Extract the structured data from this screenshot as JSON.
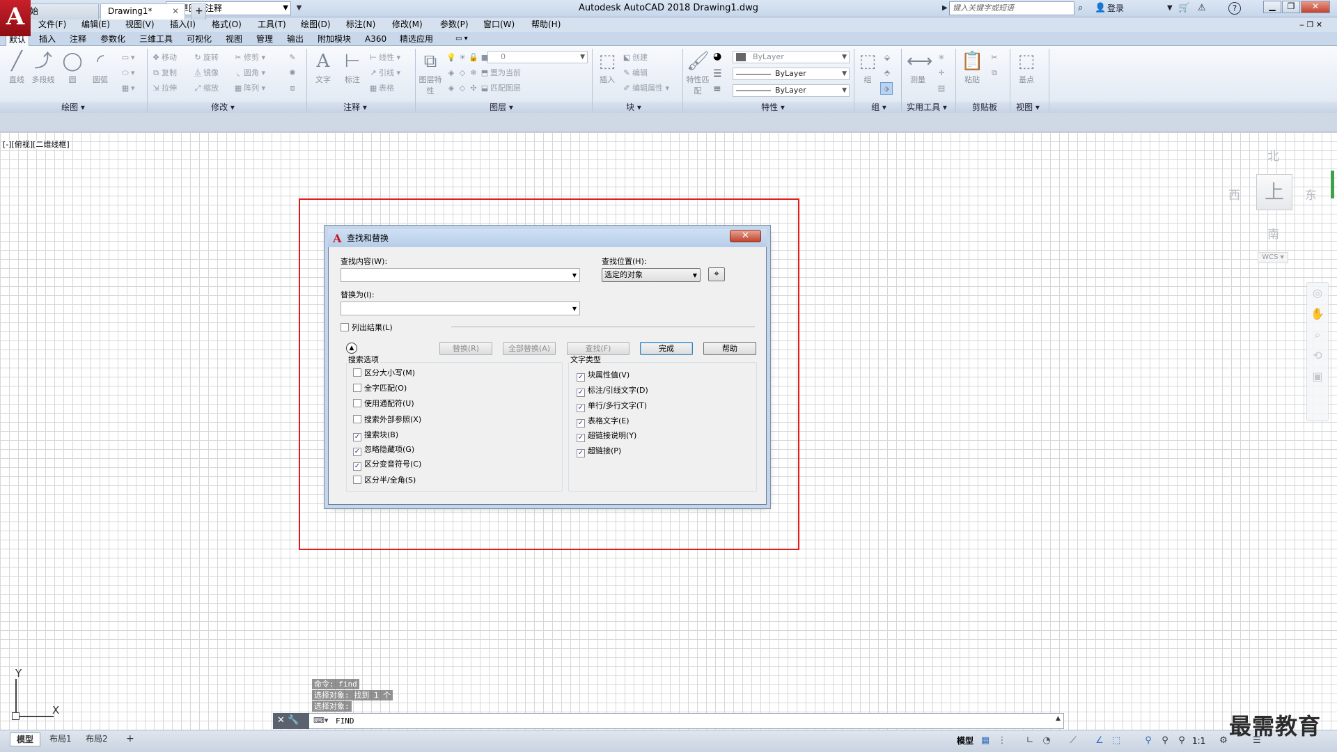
{
  "titlebar": {
    "logo": "A",
    "workspace": "草图与注释",
    "title": "Autodesk AutoCAD 2018    Drawing1.dwg",
    "search_placeholder": "键入关键字或短语",
    "login": "登录",
    "help": "?"
  },
  "menubar": {
    "items": [
      "文件(F)",
      "编辑(E)",
      "视图(V)",
      "插入(I)",
      "格式(O)",
      "工具(T)",
      "绘图(D)",
      "标注(N)",
      "修改(M)",
      "参数(P)",
      "窗口(W)",
      "帮助(H)"
    ]
  },
  "ribbon_tabs": [
    "默认",
    "插入",
    "注释",
    "参数化",
    "三维工具",
    "可视化",
    "视图",
    "管理",
    "输出",
    "附加模块",
    "A360",
    "精选应用"
  ],
  "ribbon": {
    "draw": {
      "title": "绘图",
      "tools": [
        "直线",
        "多段线",
        "圆",
        "圆弧"
      ]
    },
    "modify": {
      "title": "修改",
      "tools": [
        "移动",
        "旋转",
        "修剪",
        "复制",
        "镜像",
        "圆角",
        "拉伸",
        "缩放",
        "阵列"
      ]
    },
    "annotation": {
      "title": "注释",
      "tools": [
        "文字",
        "标注",
        "线性",
        "引线",
        "表格"
      ]
    },
    "layers": {
      "title": "图层",
      "tools": [
        "图层特性",
        "置为当前",
        "匹配图层"
      ],
      "current_layer": "0"
    },
    "block": {
      "title": "块",
      "tools": [
        "插入",
        "创建",
        "编辑",
        "编辑属性"
      ]
    },
    "properties": {
      "title": "特性",
      "tools": [
        "特性匹配"
      ],
      "color": "ByLayer",
      "linetype": "ByLayer",
      "lineweight": "ByLayer"
    },
    "groups": {
      "title": "组",
      "tools": [
        "组"
      ]
    },
    "utilities": {
      "title": "实用工具",
      "tools": [
        "测量"
      ]
    },
    "clipboard": {
      "title": "剪贴板",
      "tools": [
        "粘贴"
      ]
    },
    "view": {
      "title": "视图",
      "tools": [
        "基点"
      ]
    }
  },
  "file_tabs": {
    "start": "开始",
    "drawing": "Drawing1*"
  },
  "viewport_label": "[-][俯视][二维线框]",
  "viewcube": {
    "north": "北",
    "south": "南",
    "east": "东",
    "west": "西",
    "face": "上",
    "wcs": "WCS"
  },
  "ucs": {
    "x": "X",
    "y": "Y"
  },
  "command": {
    "history": [
      "命令:  find",
      "选择对象: 找到 1 个",
      "选择对象:"
    ],
    "input": "FIND"
  },
  "layout_tabs": [
    "模型",
    "布局1",
    "布局2"
  ],
  "status": {
    "model": "模型",
    "scale": "1:1"
  },
  "watermark": "最需教育",
  "dialog": {
    "title": "查找和替换",
    "find_label": "查找内容(W):",
    "find_value": "",
    "location_label": "查找位置(H):",
    "location_value": "选定的对象",
    "replace_label": "替换为(I):",
    "replace_value": "",
    "list_results": "列出结果(L)",
    "buttons": {
      "replace": "替换(R)",
      "replace_all": "全部替换(A)",
      "find": "查找(F)",
      "done": "完成",
      "help": "帮助"
    },
    "search_options": {
      "title": "搜索选项",
      "items": [
        {
          "label": "区分大小写(M)",
          "checked": false
        },
        {
          "label": "全字匹配(O)",
          "checked": false
        },
        {
          "label": "使用通配符(U)",
          "checked": false
        },
        {
          "label": "搜索外部参照(X)",
          "checked": false
        },
        {
          "label": "搜索块(B)",
          "checked": true
        },
        {
          "label": "忽略隐藏项(G)",
          "checked": true
        },
        {
          "label": "区分变音符号(C)",
          "checked": true
        },
        {
          "label": "区分半/全角(S)",
          "checked": false
        }
      ]
    },
    "text_types": {
      "title": "文字类型",
      "items": [
        {
          "label": "块属性值(V)",
          "checked": true
        },
        {
          "label": "标注/引线文字(D)",
          "checked": true
        },
        {
          "label": "单行/多行文字(T)",
          "checked": true
        },
        {
          "label": "表格文字(E)",
          "checked": true
        },
        {
          "label": "超链接说明(Y)",
          "checked": true
        },
        {
          "label": "超链接(P)",
          "checked": true
        }
      ]
    }
  },
  "colors": {
    "accent": "#c8141e",
    "highlight": "#e21a1a",
    "titlebar": "#c6d6ea"
  }
}
